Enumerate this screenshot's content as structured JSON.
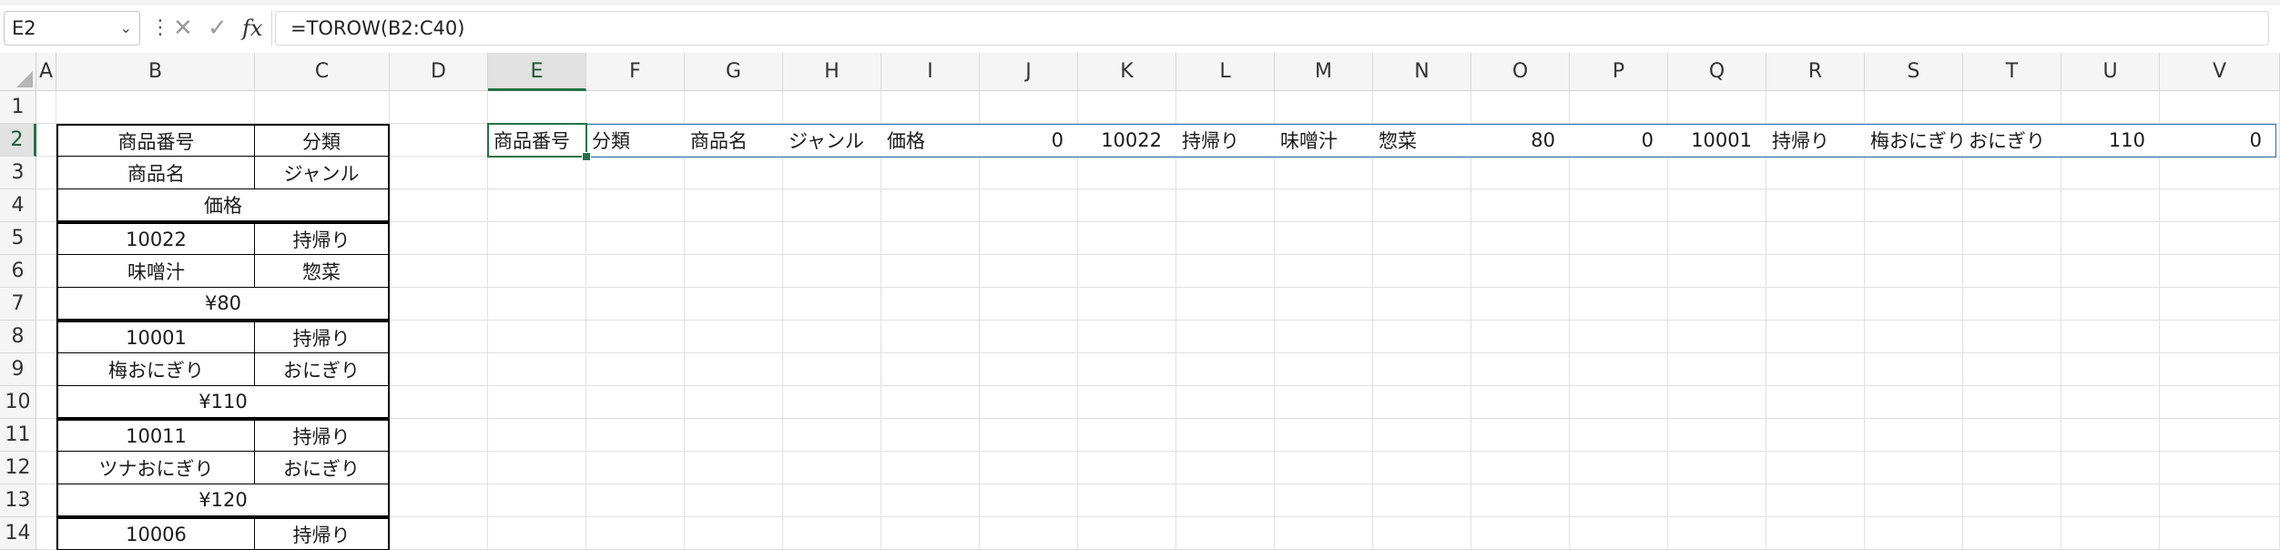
{
  "formula_bar": {
    "name_box": "E2",
    "more_icon": "⋮",
    "cancel_icon": "✕",
    "enter_icon": "✓",
    "fx_label": "fx",
    "formula": "=TOROW(B2:C40)"
  },
  "columns": [
    "A",
    "B",
    "C",
    "D",
    "E",
    "F",
    "G",
    "H",
    "I",
    "J",
    "K",
    "L",
    "M",
    "N",
    "O",
    "P",
    "Q",
    "R",
    "S",
    "T",
    "U",
    "V"
  ],
  "rows": [
    "1",
    "2",
    "3",
    "4",
    "5",
    "6",
    "7",
    "8",
    "9",
    "10",
    "11",
    "12",
    "13",
    "14"
  ],
  "selected_cell": "E2",
  "table": {
    "r2": {
      "B": "商品番号",
      "C": "分類"
    },
    "r3": {
      "B": "商品名",
      "C": "ジャンル"
    },
    "r4": {
      "BC": "価格"
    },
    "r5": {
      "B": "10022",
      "C": "持帰り"
    },
    "r6": {
      "B": "味噌汁",
      "C": "惣菜"
    },
    "r7": {
      "BC": "¥80"
    },
    "r8": {
      "B": "10001",
      "C": "持帰り"
    },
    "r9": {
      "B": "梅おにぎり",
      "C": "おにぎり"
    },
    "r10": {
      "BC": "¥110"
    },
    "r11": {
      "B": "10011",
      "C": "持帰り"
    },
    "r12": {
      "B": "ツナおにぎり",
      "C": "おにぎり"
    },
    "r13": {
      "BC": "¥120"
    },
    "r14": {
      "B": "10006",
      "C": "持帰り"
    }
  },
  "spill_row": [
    {
      "col": "E",
      "value": "商品番号",
      "type": "text"
    },
    {
      "col": "F",
      "value": "分類",
      "type": "text"
    },
    {
      "col": "G",
      "value": "商品名",
      "type": "text"
    },
    {
      "col": "H",
      "value": "ジャンル",
      "type": "text"
    },
    {
      "col": "I",
      "value": "価格",
      "type": "text"
    },
    {
      "col": "J",
      "value": "0",
      "type": "num"
    },
    {
      "col": "K",
      "value": "10022",
      "type": "num"
    },
    {
      "col": "L",
      "value": "持帰り",
      "type": "text"
    },
    {
      "col": "M",
      "value": "味噌汁",
      "type": "text"
    },
    {
      "col": "N",
      "value": "惣菜",
      "type": "text"
    },
    {
      "col": "O",
      "value": "80",
      "type": "num"
    },
    {
      "col": "P",
      "value": "0",
      "type": "num"
    },
    {
      "col": "Q",
      "value": "10001",
      "type": "num"
    },
    {
      "col": "R",
      "value": "持帰り",
      "type": "text"
    },
    {
      "col": "S",
      "value": "梅おにぎり",
      "type": "text"
    },
    {
      "col": "T",
      "value": "おにぎり",
      "type": "text"
    },
    {
      "col": "U",
      "value": "110",
      "type": "num"
    },
    {
      "col": "V",
      "value": "0",
      "type": "num"
    }
  ]
}
